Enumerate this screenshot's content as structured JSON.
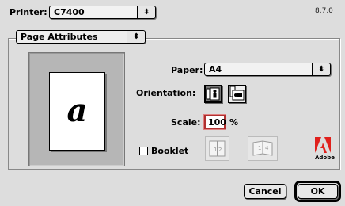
{
  "header": {
    "printer_label": "Printer:",
    "printer_value": "C7400",
    "version": "8.7.0"
  },
  "panel_menu": {
    "value": "Page Attributes"
  },
  "preview": {
    "glyph": "a"
  },
  "paper": {
    "label": "Paper:",
    "value": "A4"
  },
  "orientation": {
    "label": "Orientation:",
    "options": [
      {
        "name": "portrait",
        "selected": true
      },
      {
        "name": "landscape",
        "selected": false
      }
    ]
  },
  "scale": {
    "label": "Scale:",
    "value": "100",
    "unit": "%"
  },
  "booklet": {
    "label": "Booklet",
    "checked": false,
    "icon_names": [
      "booklet-binding-left-icon",
      "booklet-binding-right-icon"
    ]
  },
  "logo": {
    "name": "adobe-logo",
    "text": "Adobe"
  },
  "buttons": {
    "cancel": "Cancel",
    "ok": "OK"
  },
  "colors": {
    "dialog_bg": "#dddddd",
    "focus_ring": "#b03030",
    "adobe_red": "#e0201c"
  }
}
